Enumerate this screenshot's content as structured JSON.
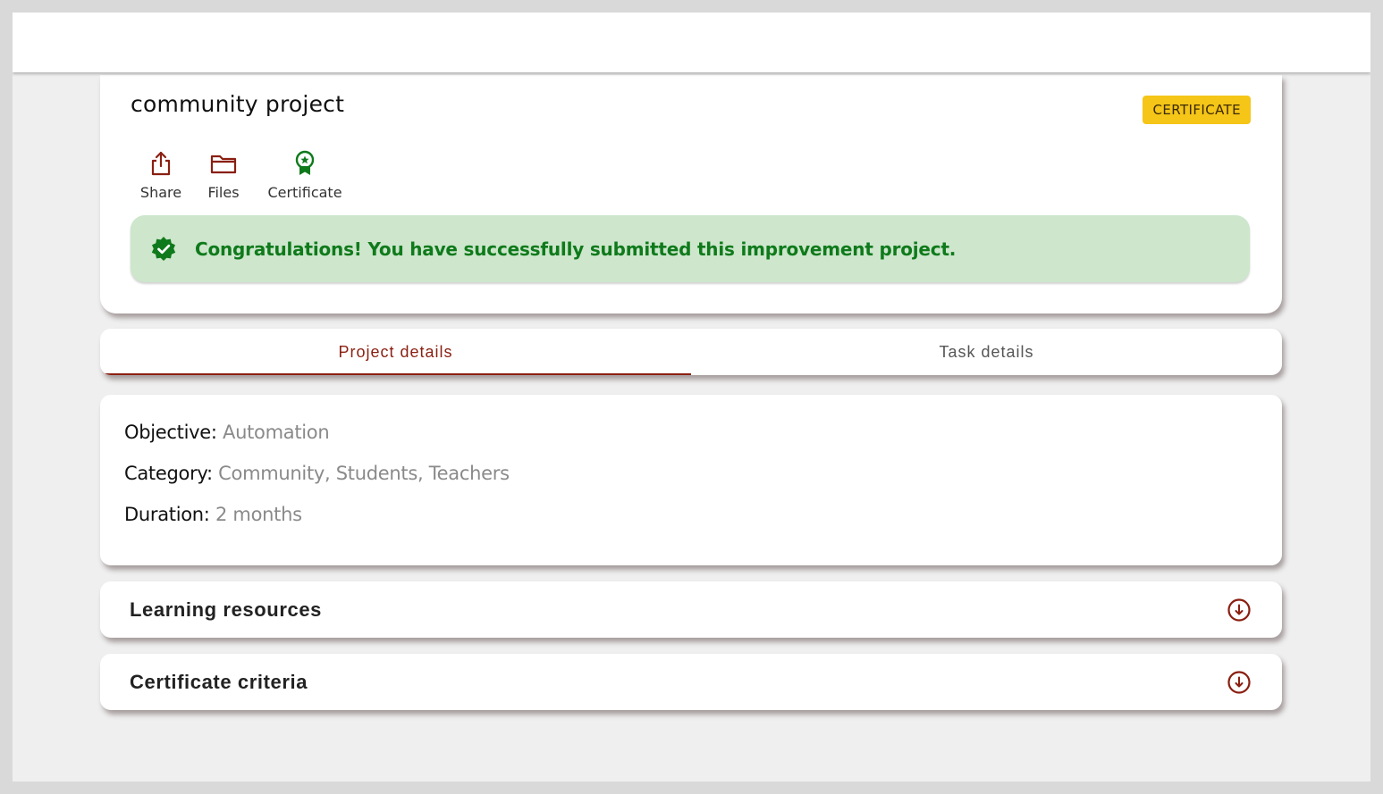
{
  "project": {
    "title": "community project",
    "badge": "CERTIFICATE"
  },
  "actions": [
    {
      "label": "Share",
      "icon": "share-icon"
    },
    {
      "label": "Files",
      "icon": "folder-icon"
    },
    {
      "label": "Certificate",
      "icon": "certificate-icon"
    }
  ],
  "success": {
    "message": "Congratulations! You have successfully submitted this improvement project.",
    "icon": "verified-check-icon"
  },
  "tabs": [
    {
      "label": "Project details",
      "active": true
    },
    {
      "label": "Task details",
      "active": false
    }
  ],
  "details": {
    "objective_label": "Objective:",
    "objective_value": "Automation",
    "category_label": "Category:",
    "category_value": "Community, Students, Teachers",
    "duration_label": "Duration:",
    "duration_value": "2 months"
  },
  "accordions": [
    {
      "title": "Learning resources",
      "icon": "expand-down-circle-icon"
    },
    {
      "title": "Certificate criteria",
      "icon": "expand-down-circle-icon"
    }
  ],
  "colors": {
    "accent": "#8a1f11",
    "badge": "#f5c518",
    "success_bg": "#cde6cc",
    "success_text": "#0f7a1b",
    "certificate_icon": "#0f7a1b"
  }
}
